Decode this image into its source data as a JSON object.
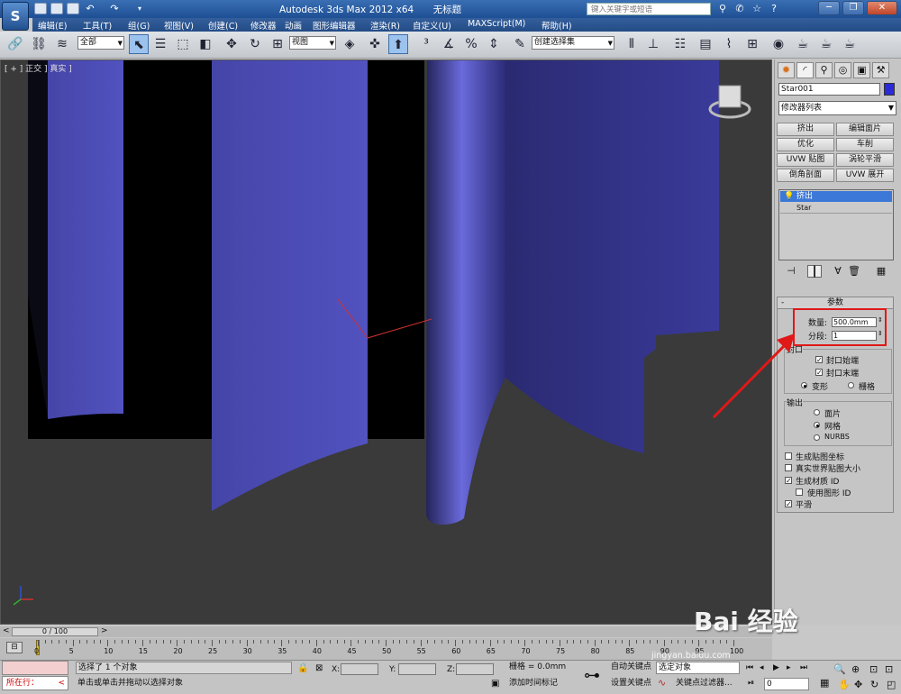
{
  "window": {
    "app_title": "Autodesk 3ds Max  2012 x64",
    "doc_title": "无标题",
    "search_placeholder": "键入关键字或短语"
  },
  "menu": [
    "编辑(E)",
    "工具(T)",
    "组(G)",
    "视图(V)",
    "创建(C)",
    "修改器",
    "动画",
    "图形编辑器",
    "渲染(R)",
    "自定义(U)",
    "MAXScript(M)",
    "帮助(H)"
  ],
  "toolbar": {
    "selection_filter": "全部",
    "ref_coord": "视图",
    "named_selection": "创建选择集"
  },
  "viewport": {
    "label": "[ + ] 正交 ] 真实 ]"
  },
  "command_panel": {
    "object_name": "Star001",
    "object_color": "#2b2bd8",
    "modifier_list": "修改器列表",
    "modifier_buttons": [
      [
        "挤出",
        "编辑面片"
      ],
      [
        "优化",
        "车削"
      ],
      [
        "UVW 贴图",
        "涡轮平滑"
      ],
      [
        "倒角剖面",
        "UVW 展开"
      ]
    ],
    "stack": {
      "selected": "挤出",
      "base": "Star"
    },
    "params": {
      "rollout_title": "参数",
      "amount_label": "数量:",
      "amount_value": "500.0mm",
      "segments_label": "分段:",
      "segments_value": "1",
      "capping_label": "封口",
      "cap_start": "封口始端",
      "cap_end": "封口末端",
      "morph": "变形",
      "grid": "栅格",
      "output_label": "输出",
      "output_patch": "面片",
      "output_mesh": "网格",
      "output_nurbs": "NURBS",
      "gen_mapping": "生成贴图坐标",
      "real_world": "真实世界贴图大小",
      "gen_mat_ids": "生成材质 ID",
      "use_shape_ids": "使用图形 ID",
      "smooth": "平滑"
    }
  },
  "timeline": {
    "frame_display": "0 / 100",
    "ticks": [
      "0",
      "5",
      "10",
      "15",
      "20",
      "25",
      "30",
      "35",
      "40",
      "45",
      "50",
      "55",
      "60",
      "65",
      "70",
      "75",
      "80",
      "85",
      "90",
      "95",
      "100"
    ]
  },
  "status": {
    "script_listener": "所在行：",
    "selected_msg": "选择了 1 个对象",
    "prompt_msg": "单击或单击并拖动以选择对象",
    "x_label": "X:",
    "y_label": "Y:",
    "z_label": "Z:",
    "grid_text": "栅格 = 0.0mm",
    "add_time_tag": "添加时间标记",
    "auto_key": "自动关键点",
    "selected_object": "选定对象",
    "set_key": "设置关键点",
    "key_filters": "关键点过滤器...",
    "frame_value": "0"
  },
  "watermark": {
    "logo_text": "Bai 经验",
    "url": "jingyan.baidu.com"
  }
}
